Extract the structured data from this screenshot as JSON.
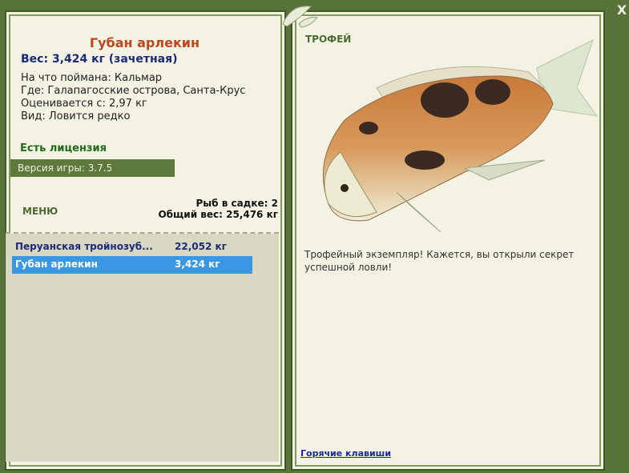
{
  "fish": {
    "title": "Губан арлекин",
    "weight_line": "Вес: 3,424 кг (зачетная)",
    "bait": "На что поймана: Кальмар",
    "location": "Где: Галапагосские острова, Санта-Крус",
    "valued_from": "Оценивается с: 2,97 кг",
    "rarity": "Вид: Ловится редко"
  },
  "license": "Есть лицензия",
  "version": "Версия игры: 3.7.5",
  "menu_label": "МЕНЮ",
  "stats": {
    "fish_in_keepnet": "Рыб в садке: 2",
    "total_weight": "Общий вес: 25,476 кг"
  },
  "catch_list": [
    {
      "name": "Перуанская тройнозуб...",
      "weight": "22,052 кг"
    },
    {
      "name": "Губан арлекин",
      "weight": "3,424 кг"
    }
  ],
  "trophy_label": "ТРОФЕЙ",
  "trophy_text": "Трофейный экземпляр! Кажется, вы открыли секрет успешной ловли!",
  "hotkeys_label": "Горячие клавиши",
  "close_label": "X",
  "colors": {
    "background": "#57733a",
    "panel": "#f3f2e3",
    "title": "#c0461d",
    "selected_row": "#3a97e4",
    "version_bar": "#5d7a3c"
  }
}
